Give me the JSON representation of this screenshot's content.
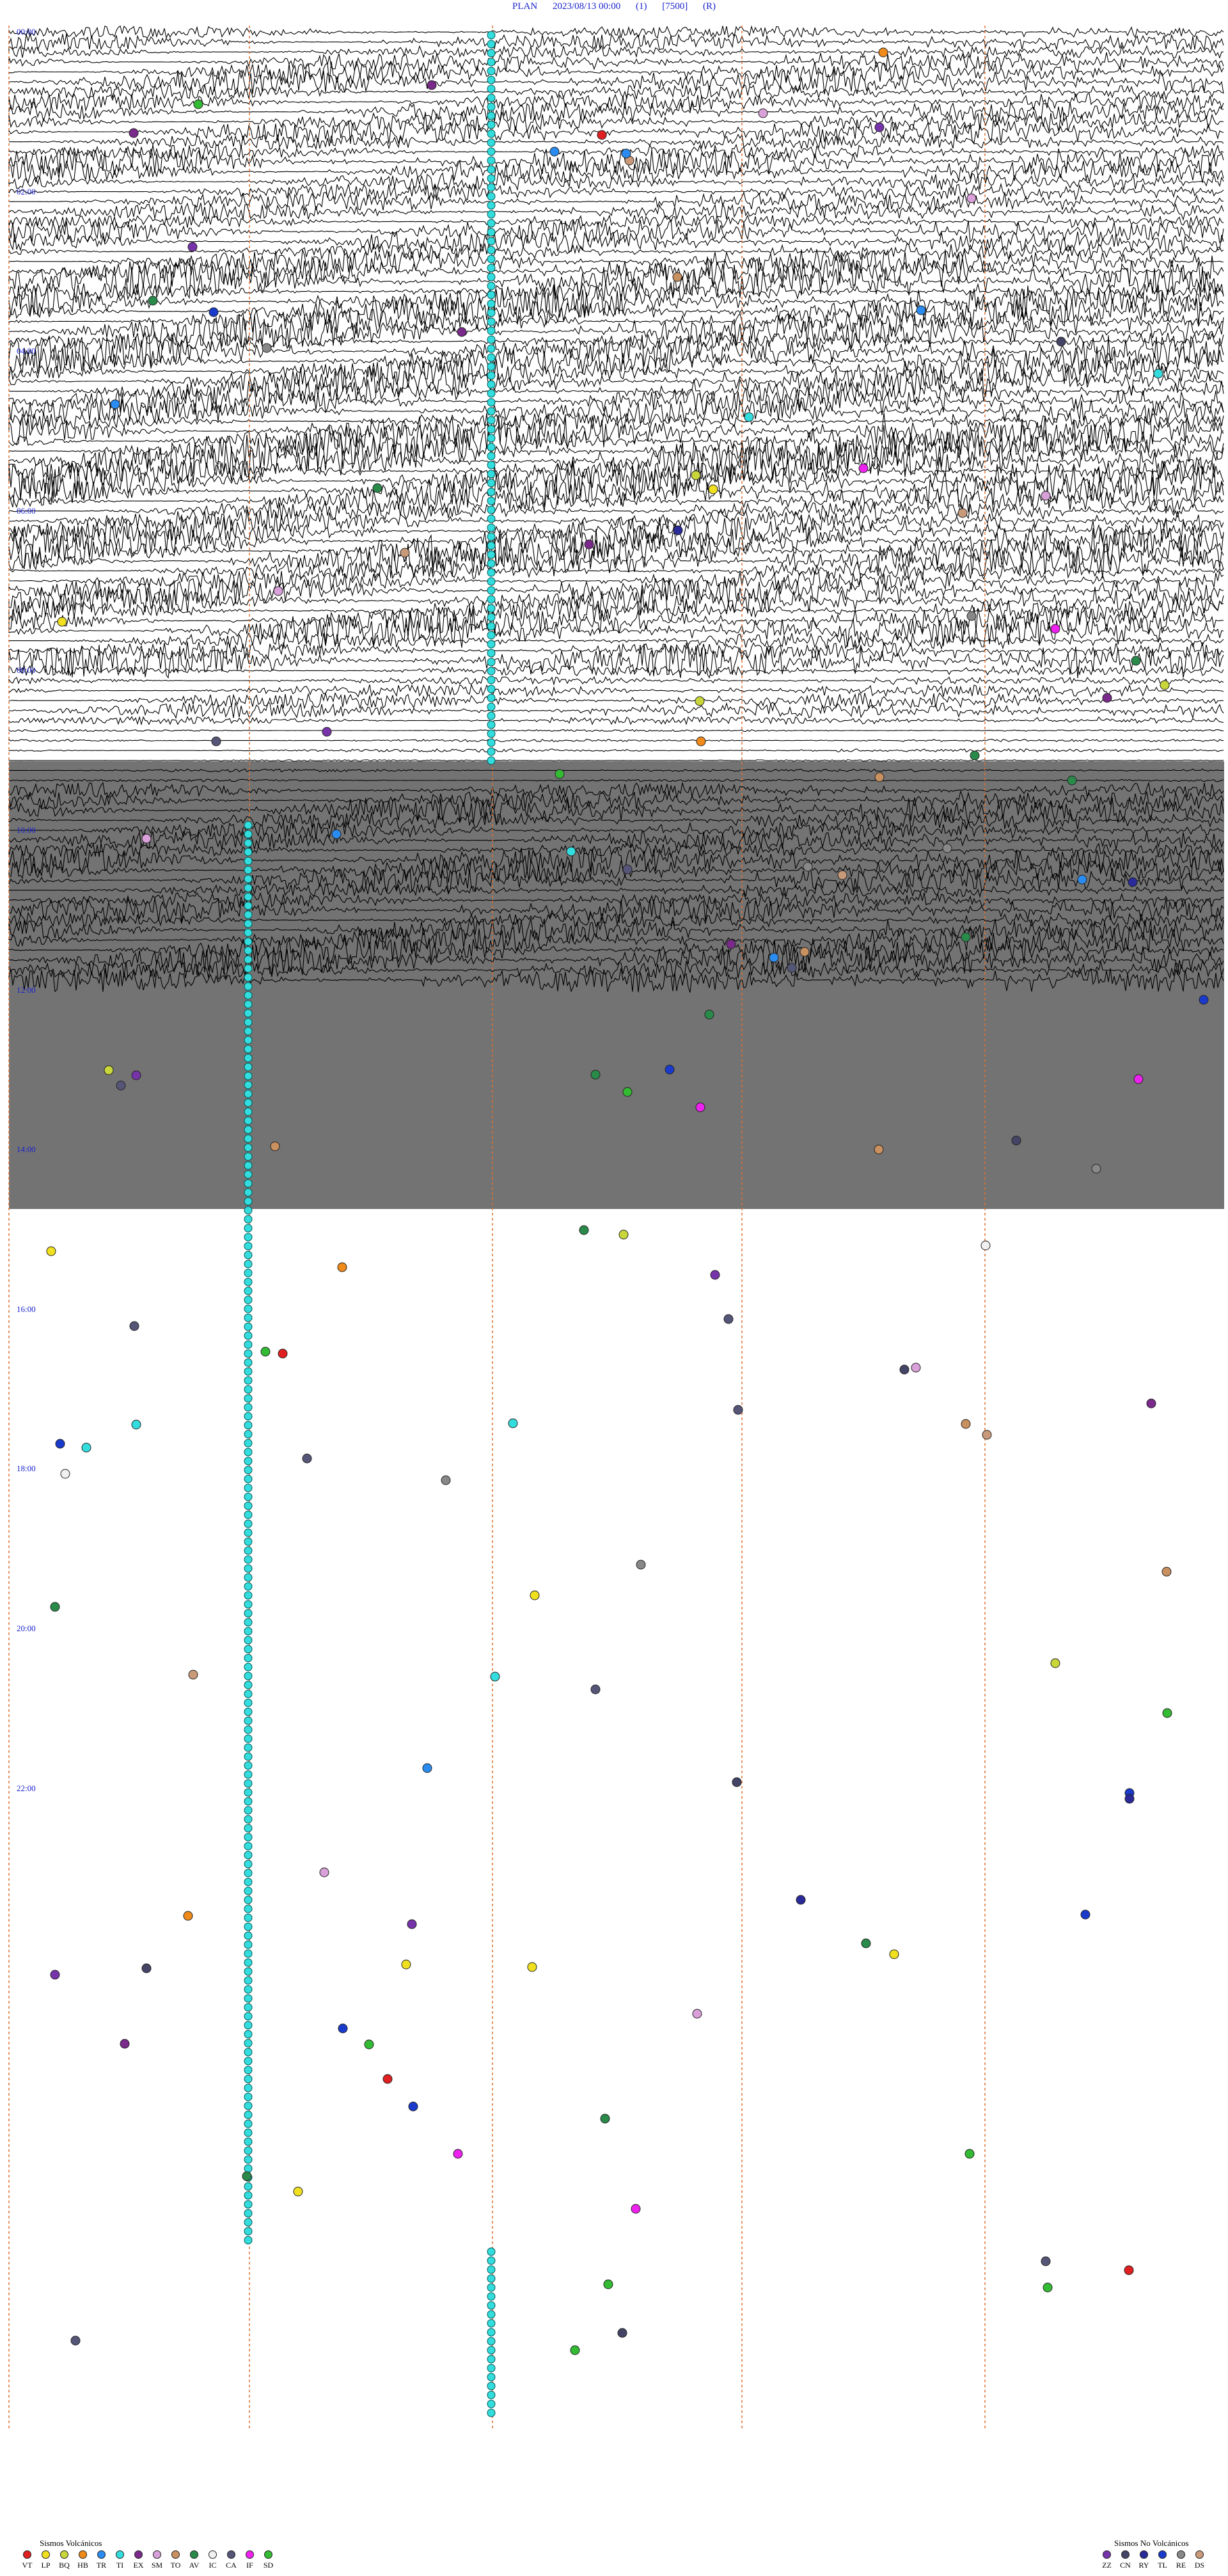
{
  "header": {
    "station": "PLAN",
    "datetime": "2023/08/13 00:00",
    "channel": "(1)",
    "scale": "[7500]",
    "mode": "(R)"
  },
  "hour_labels": [
    "00:00",
    "02:00",
    "04:00",
    "06:00",
    "08:00",
    "10:00",
    "12:00",
    "14:00",
    "16:00",
    "18:00",
    "20:00",
    "22:00"
  ],
  "legend_volcanic": {
    "title": "Sismos Volcánicos",
    "items": [
      {
        "code": "VT",
        "color": "#e02020"
      },
      {
        "code": "LP",
        "color": "#f0e020"
      },
      {
        "code": "BQ",
        "color": "#c9d63a"
      },
      {
        "code": "HB",
        "color": "#f08a1a"
      },
      {
        "code": "TR",
        "color": "#2a8cf0"
      },
      {
        "code": "TI",
        "color": "#33dddd"
      },
      {
        "code": "EX",
        "color": "#7a2a8a"
      },
      {
        "code": "SM",
        "color": "#d9a0d9"
      },
      {
        "code": "TO",
        "color": "#c99060"
      },
      {
        "code": "AV",
        "color": "#2a8a4a"
      },
      {
        "code": "IC",
        "color": "#f0f0f0"
      },
      {
        "code": "CA",
        "color": "#555577"
      },
      {
        "code": "IF",
        "color": "#ee22ee"
      },
      {
        "code": "SD",
        "color": "#33bb33"
      }
    ]
  },
  "legend_nonvolcanic": {
    "title": "Sismos No Volcánicos",
    "items": [
      {
        "code": "ZZ",
        "color": "#7733aa"
      },
      {
        "code": "CN",
        "color": "#444466"
      },
      {
        "code": "RY",
        "color": "#2a2a9a"
      },
      {
        "code": "TL",
        "color": "#1a3acc"
      },
      {
        "code": "RE",
        "color": "#888888"
      },
      {
        "code": "DS",
        "color": "#c99a7a"
      }
    ]
  },
  "colors": {
    "label_blue": "#1a22cc",
    "trace": "#000000",
    "marker_line": "#e07030",
    "ti_cyan": "#33dddd"
  }
}
